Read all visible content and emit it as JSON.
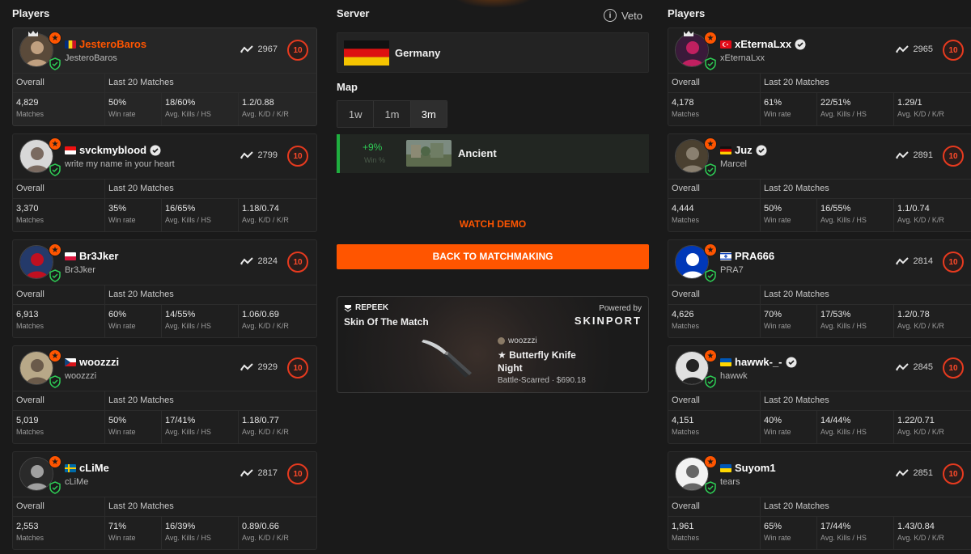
{
  "left": {
    "title": "Players",
    "players": [
      {
        "nick": "JesteroBaros",
        "sub": "JesteroBaros",
        "elo": "2967",
        "level": "10",
        "flag": "ro",
        "verified": false,
        "highlight": true,
        "crown": true,
        "overall_label": "Overall",
        "last_label": "Last 20 Matches",
        "stats": [
          {
            "v": "4,829",
            "l": "Matches"
          },
          {
            "v": "50%",
            "l": "Win rate"
          },
          {
            "v": "18/60%",
            "l": "Avg. Kills / HS"
          },
          {
            "v": "1.2/0.88",
            "l": "Avg. K/D / K/R"
          }
        ]
      },
      {
        "nick": "svckmyblood",
        "sub": "write my name in your heart",
        "elo": "2799",
        "level": "10",
        "flag": "id",
        "verified": true,
        "overall_label": "Overall",
        "last_label": "Last 20 Matches",
        "stats": [
          {
            "v": "3,370",
            "l": "Matches"
          },
          {
            "v": "35%",
            "l": "Win rate"
          },
          {
            "v": "16/65%",
            "l": "Avg. Kills / HS"
          },
          {
            "v": "1.18/0.74",
            "l": "Avg. K/D / K/R"
          }
        ]
      },
      {
        "nick": "Br3Jker",
        "sub": "Br3Jker",
        "elo": "2824",
        "level": "10",
        "flag": "pl",
        "verified": false,
        "overall_label": "Overall",
        "last_label": "Last 20 Matches",
        "stats": [
          {
            "v": "6,913",
            "l": "Matches"
          },
          {
            "v": "60%",
            "l": "Win rate"
          },
          {
            "v": "14/55%",
            "l": "Avg. Kills / HS"
          },
          {
            "v": "1.06/0.69",
            "l": "Avg. K/D / K/R"
          }
        ]
      },
      {
        "nick": "woozzzi",
        "sub": "woozzzi",
        "elo": "2929",
        "level": "10",
        "flag": "cz",
        "verified": false,
        "overall_label": "Overall",
        "last_label": "Last 20 Matches",
        "stats": [
          {
            "v": "5,019",
            "l": "Matches"
          },
          {
            "v": "50%",
            "l": "Win rate"
          },
          {
            "v": "17/41%",
            "l": "Avg. Kills / HS"
          },
          {
            "v": "1.18/0.77",
            "l": "Avg. K/D / K/R"
          }
        ]
      },
      {
        "nick": "cLiMe",
        "sub": "cLiMe",
        "elo": "2817",
        "level": "10",
        "flag": "se",
        "verified": false,
        "overall_label": "Overall",
        "last_label": "Last 20 Matches",
        "stats": [
          {
            "v": "2,553",
            "l": "Matches"
          },
          {
            "v": "71%",
            "l": "Win rate"
          },
          {
            "v": "16/39%",
            "l": "Avg. Kills / HS"
          },
          {
            "v": "0.89/0.66",
            "l": "Avg. K/D / K/R"
          }
        ]
      }
    ]
  },
  "right": {
    "title": "Players",
    "players": [
      {
        "nick": "xEternaLxx",
        "sub": "xEternaLxx",
        "elo": "2965",
        "level": "10",
        "flag": "tr",
        "verified": true,
        "crown": true,
        "overall_label": "Overall",
        "last_label": "Last 20 Matches",
        "stats": [
          {
            "v": "4,178",
            "l": "Matches"
          },
          {
            "v": "61%",
            "l": "Win rate"
          },
          {
            "v": "22/51%",
            "l": "Avg. Kills / HS"
          },
          {
            "v": "1.29/1",
            "l": "Avg. K/D / K/R"
          }
        ]
      },
      {
        "nick": "Juz",
        "sub": "Marcel",
        "elo": "2891",
        "level": "10",
        "flag": "de",
        "verified": true,
        "overall_label": "Overall",
        "last_label": "Last 20 Matches",
        "stats": [
          {
            "v": "4,444",
            "l": "Matches"
          },
          {
            "v": "50%",
            "l": "Win rate"
          },
          {
            "v": "16/55%",
            "l": "Avg. Kills / HS"
          },
          {
            "v": "1.1/0.74",
            "l": "Avg. K/D / K/R"
          }
        ]
      },
      {
        "nick": "PRA666",
        "sub": "PRA7",
        "elo": "2814",
        "level": "10",
        "flag": "il",
        "verified": false,
        "overall_label": "Overall",
        "last_label": "Last 20 Matches",
        "stats": [
          {
            "v": "4,626",
            "l": "Matches"
          },
          {
            "v": "70%",
            "l": "Win rate"
          },
          {
            "v": "17/53%",
            "l": "Avg. Kills / HS"
          },
          {
            "v": "1.2/0.78",
            "l": "Avg. K/D / K/R"
          }
        ]
      },
      {
        "nick": "hawwk-_-",
        "sub": "hawwk",
        "elo": "2845",
        "level": "10",
        "flag": "ua",
        "verified": true,
        "overall_label": "Overall",
        "last_label": "Last 20 Matches",
        "stats": [
          {
            "v": "4,151",
            "l": "Matches"
          },
          {
            "v": "40%",
            "l": "Win rate"
          },
          {
            "v": "14/44%",
            "l": "Avg. Kills / HS"
          },
          {
            "v": "1.22/0.71",
            "l": "Avg. K/D / K/R"
          }
        ]
      },
      {
        "nick": "Suyom1",
        "sub": "tears",
        "elo": "2851",
        "level": "10",
        "flag": "ua",
        "verified": false,
        "overall_label": "Overall",
        "last_label": "Last 20 Matches",
        "stats": [
          {
            "v": "1,961",
            "l": "Matches"
          },
          {
            "v": "65%",
            "l": "Win rate"
          },
          {
            "v": "17/44%",
            "l": "Avg. Kills / HS"
          },
          {
            "v": "1.43/0.84",
            "l": "Avg. K/D / K/R"
          }
        ]
      }
    ]
  },
  "center": {
    "server_title": "Server",
    "veto_label": "Veto",
    "server_name": "Germany",
    "map_title": "Map",
    "tabs": [
      "1w",
      "1m",
      "3m"
    ],
    "active_tab": "3m",
    "map": {
      "pct": "+9%",
      "win_label": "Win %",
      "name": "Ancient"
    },
    "watch_demo": "WATCH DEMO",
    "back_button": "BACK TO MATCHMAKING",
    "skin": {
      "brand": "REPEEK",
      "title": "Skin Of The Match",
      "powered_by": "Powered by",
      "sponsor": "SKINPORT",
      "owner": "woozzzi",
      "item_name": "★ Butterfly Knife Night",
      "item_detail": "Battle-Scarred · $690.18"
    }
  },
  "colors": {
    "accent": "#ff5500",
    "background": "#1a1a1a",
    "card": "#1f1f1f",
    "win_green": "#2ecc55",
    "level_red": "#e63a1f"
  },
  "icons": {
    "elo": "elo-trend-icon",
    "verified": "verified-check-icon",
    "veto": "info-icon",
    "shield": "shield-check-icon"
  }
}
